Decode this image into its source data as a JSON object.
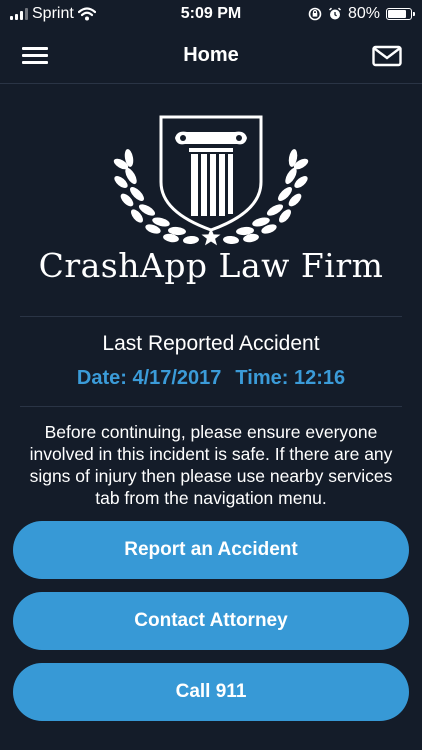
{
  "status_bar": {
    "carrier": "Sprint",
    "time": "5:09 PM",
    "battery_percent": "80%",
    "battery_level": 0.8,
    "icons": [
      "signal-icon",
      "wifi-icon",
      "orientation-lock-icon",
      "alarm-icon",
      "battery-icon"
    ]
  },
  "nav": {
    "title": "Home",
    "left_icon": "hamburger-menu-icon",
    "right_icon": "mail-icon"
  },
  "brand": {
    "firm_name": "CrashApp Law Firm",
    "logo_icon": "pillar-shield-laurel-logo"
  },
  "last_accident": {
    "heading": "Last Reported Accident",
    "date_text": "Date: 4/17/2017",
    "time_text": "Time: 12:16"
  },
  "notice": "Before continuing, please ensure everyone involved in this incident is safe. If there are any signs of injury then please use nearby services tab from the navigation menu.",
  "actions": {
    "report_label": "Report an Accident",
    "attorney_label": "Contact Attorney",
    "call_label": "Call 911"
  },
  "colors": {
    "background": "#141c29",
    "accent": "#3799d6",
    "date_text": "#3b9bd8"
  }
}
